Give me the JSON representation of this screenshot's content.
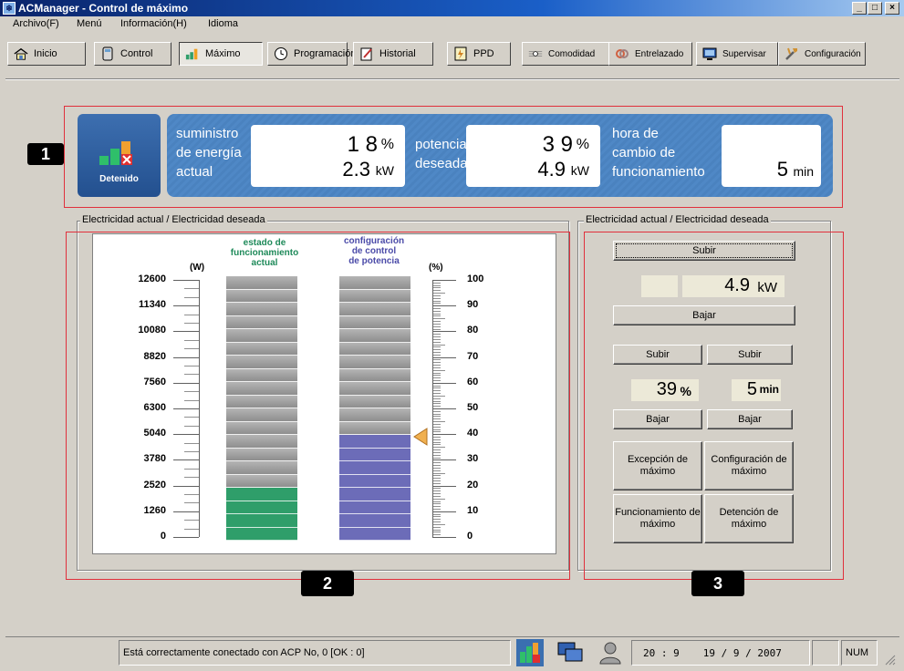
{
  "window": {
    "title": "ACManager - Control de máximo"
  },
  "menu": [
    "Archivo(F)",
    "Menú",
    "Información(H)",
    "Idioma"
  ],
  "toolbar": [
    {
      "label": "Inicio",
      "icon": "home-icon"
    },
    {
      "label": "Control",
      "icon": "remote-icon"
    },
    {
      "label": "Máximo",
      "icon": "bars-icon"
    },
    {
      "label": "Programación",
      "icon": "clock-icon"
    },
    {
      "label": "Historial",
      "icon": "edit-icon"
    },
    {
      "label": "PPD",
      "icon": "ppd-icon"
    },
    {
      "label": "Comodidad",
      "icon": "comfort-icon"
    },
    {
      "label": "Entrelazado",
      "icon": "interlock-icon"
    },
    {
      "label": "Supervisar",
      "icon": "monitor-icon"
    },
    {
      "label": "Configuración",
      "icon": "tools-icon"
    }
  ],
  "info": {
    "status_label": "Detenido",
    "supply_label_1": "suministro",
    "supply_label_2": "de energía",
    "supply_label_3": "actual",
    "supply_percent": "1 8",
    "supply_percent_unit": "%",
    "supply_kw": "2.3",
    "supply_kw_unit": "kW",
    "desired_label_1": "potencia",
    "desired_label_2": "deseada",
    "desired_percent": "3 9",
    "desired_percent_unit": "%",
    "desired_kw": "4.9",
    "desired_kw_unit": "kW",
    "time_label_1": "hora de",
    "time_label_2": "cambio de",
    "time_label_3": "funcionamiento",
    "time_value": "5",
    "time_unit": "min"
  },
  "badges": [
    "1",
    "2",
    "3"
  ],
  "gauge_group": {
    "title": "Electricidad actual / Electricidad deseada",
    "left_unit": "(W)",
    "right_unit": "(%)",
    "bar1_title_1": "estado de",
    "bar1_title_2": "funcionamiento",
    "bar1_title_3": "actual",
    "bar2_title_1": "configuración",
    "bar2_title_2": "de control",
    "bar2_title_3": "de potencia",
    "w_ticks": [
      "12600",
      "11340",
      "10080",
      "8820",
      "7560",
      "6300",
      "5040",
      "3780",
      "2520",
      "1260",
      "0"
    ],
    "pct_ticks": [
      "100",
      "90",
      "80",
      "70",
      "60",
      "50",
      "40",
      "30",
      "20",
      "10",
      "0"
    ],
    "actual_level_pct": 18,
    "desired_level_pct": 39,
    "colors": {
      "actual": "#2f9e6a",
      "desired": "#6c6cb8",
      "idle": "#a9a9a9",
      "marker": "#f0b050"
    }
  },
  "control_group": {
    "title": "Electricidad actual / Electricidad deseada",
    "up_label": "Subir",
    "kw_value": "4.9",
    "kw_unit": "kW",
    "down_label": "Bajar",
    "up_pct_label": "Subir",
    "up_min_label": "Subir",
    "pct_value": "39",
    "pct_unit": "%",
    "min_value": "5",
    "min_unit": "min",
    "down_pct_label": "Bajar",
    "down_min_label": "Bajar",
    "exception_label": "Excepción de máximo",
    "config_label": "Configuración de máximo",
    "run_label": "Funcionamiento de máximo",
    "stop_label": "Detención de máximo"
  },
  "statusbar": {
    "message": "Está correctamente conectado con ACP No, 0 [OK : 0]",
    "time": "20 : 9",
    "date": "19 / 9 / 2007",
    "num": "NUM"
  }
}
